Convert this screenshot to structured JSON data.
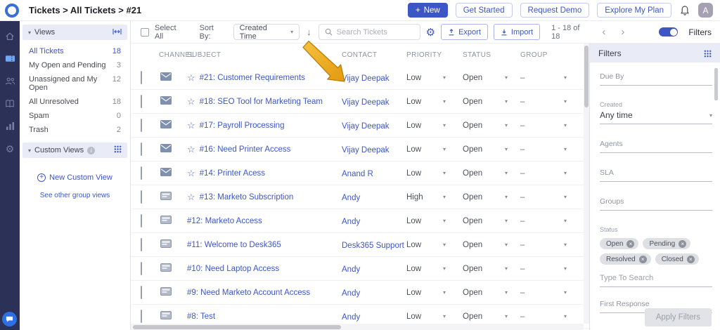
{
  "colors": {
    "accent": "#3d56c5",
    "sidebar": "#2b3157",
    "arrow": "#efac1f"
  },
  "topbar": {
    "breadcrumb": "Tickets > All Tickets > #21",
    "new_button": "New",
    "get_started_button": "Get Started",
    "request_demo_button": "Request Demo",
    "explore_plan_button": "Explore My Plan",
    "avatar_initial": "A"
  },
  "views": {
    "title": "Views",
    "items": [
      {
        "label": "All Tickets",
        "count": "18",
        "active": true
      },
      {
        "label": "My Open and Pending",
        "count": "3",
        "active": false
      },
      {
        "label": "Unassigned and My Open",
        "count": "12",
        "active": false
      },
      {
        "label": "All Unresolved",
        "count": "18",
        "active": false
      },
      {
        "label": "Spam",
        "count": "0",
        "active": false
      },
      {
        "label": "Trash",
        "count": "2",
        "active": false
      }
    ],
    "custom_views_title": "Custom Views",
    "new_custom_view_link": "New Custom View",
    "see_other_link": "See other group views"
  },
  "toolbar": {
    "select_all_label": "Select All",
    "sort_by_label": "Sort By:",
    "sort_value": "Created Time",
    "search_placeholder": "Search Tickets",
    "export_label": "Export",
    "import_label": "Import",
    "pagination": "1 - 18 of 18",
    "filters_label": "Filters"
  },
  "table": {
    "columns": [
      "CHANNEL",
      "SUBJECT",
      "CONTACT",
      "PRIORITY",
      "STATUS",
      "GROUP"
    ],
    "rows": [
      {
        "channel": "email",
        "starred": true,
        "subject": "#21: Customer Requirements",
        "contact": "Vijay Deepak",
        "priority": "Low",
        "status": "Open",
        "group": "–"
      },
      {
        "channel": "email",
        "starred": true,
        "subject": "#18: SEO Tool for Marketing Team",
        "contact": "Vijay Deepak",
        "priority": "Low",
        "status": "Open",
        "group": "–"
      },
      {
        "channel": "email",
        "starred": true,
        "subject": "#17: Payroll Processing",
        "contact": "Vijay Deepak",
        "priority": "Low",
        "status": "Open",
        "group": "–"
      },
      {
        "channel": "email",
        "starred": true,
        "subject": "#16: Need Printer Access",
        "contact": "Vijay Deepak",
        "priority": "Low",
        "status": "Open",
        "group": "–"
      },
      {
        "channel": "email",
        "starred": true,
        "subject": "#14: Printer Acess",
        "contact": "Anand R",
        "priority": "Low",
        "status": "Open",
        "group": "–"
      },
      {
        "channel": "portal",
        "starred": true,
        "subject": "#13: Marketo Subscription",
        "contact": "Andy",
        "priority": "High",
        "status": "Open",
        "group": "–"
      },
      {
        "channel": "portal",
        "starred": false,
        "subject": "#12: Marketo Access",
        "contact": "Andy",
        "priority": "Low",
        "status": "Open",
        "group": "–"
      },
      {
        "channel": "portal",
        "starred": false,
        "subject": "#11: Welcome to Desk365",
        "contact": "Desk365 Support",
        "priority": "Low",
        "status": "Open",
        "group": "–"
      },
      {
        "channel": "portal",
        "starred": false,
        "subject": "#10: Need Laptop Access",
        "contact": "Andy",
        "priority": "Low",
        "status": "Open",
        "group": "–"
      },
      {
        "channel": "portal",
        "starred": false,
        "subject": "#9: Need Marketo Account Access",
        "contact": "Andy",
        "priority": "Low",
        "status": "Open",
        "group": "–"
      },
      {
        "channel": "portal",
        "starred": false,
        "subject": "#8: Test",
        "contact": "Andy",
        "priority": "Low",
        "status": "Open",
        "group": "–"
      }
    ]
  },
  "filters": {
    "title": "Filters",
    "due_by_label": "Due By",
    "created_label": "Created",
    "created_value": "Any time",
    "agents_label": "Agents",
    "sla_label": "SLA",
    "groups_label": "Groups",
    "status_label": "Status",
    "status_chips": [
      "Open",
      "Pending",
      "Resolved",
      "Closed"
    ],
    "type_to_search_placeholder": "Type To Search",
    "first_response_label": "First Response",
    "apply_button": "Apply Filters"
  }
}
